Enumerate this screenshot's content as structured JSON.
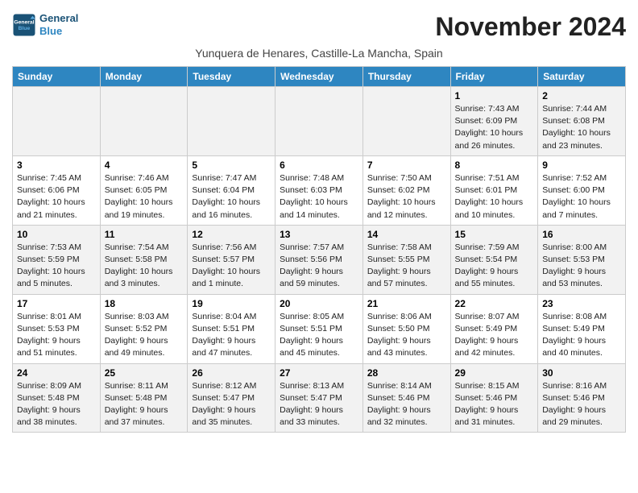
{
  "app": {
    "logo_line1": "General",
    "logo_line2": "Blue"
  },
  "header": {
    "month_title": "November 2024",
    "subtitle": "Yunquera de Henares, Castille-La Mancha, Spain"
  },
  "columns": [
    "Sunday",
    "Monday",
    "Tuesday",
    "Wednesday",
    "Thursday",
    "Friday",
    "Saturday"
  ],
  "weeks": [
    [
      {
        "day": "",
        "info": ""
      },
      {
        "day": "",
        "info": ""
      },
      {
        "day": "",
        "info": ""
      },
      {
        "day": "",
        "info": ""
      },
      {
        "day": "",
        "info": ""
      },
      {
        "day": "1",
        "info": "Sunrise: 7:43 AM\nSunset: 6:09 PM\nDaylight: 10 hours and 26 minutes."
      },
      {
        "day": "2",
        "info": "Sunrise: 7:44 AM\nSunset: 6:08 PM\nDaylight: 10 hours and 23 minutes."
      }
    ],
    [
      {
        "day": "3",
        "info": "Sunrise: 7:45 AM\nSunset: 6:06 PM\nDaylight: 10 hours and 21 minutes."
      },
      {
        "day": "4",
        "info": "Sunrise: 7:46 AM\nSunset: 6:05 PM\nDaylight: 10 hours and 19 minutes."
      },
      {
        "day": "5",
        "info": "Sunrise: 7:47 AM\nSunset: 6:04 PM\nDaylight: 10 hours and 16 minutes."
      },
      {
        "day": "6",
        "info": "Sunrise: 7:48 AM\nSunset: 6:03 PM\nDaylight: 10 hours and 14 minutes."
      },
      {
        "day": "7",
        "info": "Sunrise: 7:50 AM\nSunset: 6:02 PM\nDaylight: 10 hours and 12 minutes."
      },
      {
        "day": "8",
        "info": "Sunrise: 7:51 AM\nSunset: 6:01 PM\nDaylight: 10 hours and 10 minutes."
      },
      {
        "day": "9",
        "info": "Sunrise: 7:52 AM\nSunset: 6:00 PM\nDaylight: 10 hours and 7 minutes."
      }
    ],
    [
      {
        "day": "10",
        "info": "Sunrise: 7:53 AM\nSunset: 5:59 PM\nDaylight: 10 hours and 5 minutes."
      },
      {
        "day": "11",
        "info": "Sunrise: 7:54 AM\nSunset: 5:58 PM\nDaylight: 10 hours and 3 minutes."
      },
      {
        "day": "12",
        "info": "Sunrise: 7:56 AM\nSunset: 5:57 PM\nDaylight: 10 hours and 1 minute."
      },
      {
        "day": "13",
        "info": "Sunrise: 7:57 AM\nSunset: 5:56 PM\nDaylight: 9 hours and 59 minutes."
      },
      {
        "day": "14",
        "info": "Sunrise: 7:58 AM\nSunset: 5:55 PM\nDaylight: 9 hours and 57 minutes."
      },
      {
        "day": "15",
        "info": "Sunrise: 7:59 AM\nSunset: 5:54 PM\nDaylight: 9 hours and 55 minutes."
      },
      {
        "day": "16",
        "info": "Sunrise: 8:00 AM\nSunset: 5:53 PM\nDaylight: 9 hours and 53 minutes."
      }
    ],
    [
      {
        "day": "17",
        "info": "Sunrise: 8:01 AM\nSunset: 5:53 PM\nDaylight: 9 hours and 51 minutes."
      },
      {
        "day": "18",
        "info": "Sunrise: 8:03 AM\nSunset: 5:52 PM\nDaylight: 9 hours and 49 minutes."
      },
      {
        "day": "19",
        "info": "Sunrise: 8:04 AM\nSunset: 5:51 PM\nDaylight: 9 hours and 47 minutes."
      },
      {
        "day": "20",
        "info": "Sunrise: 8:05 AM\nSunset: 5:51 PM\nDaylight: 9 hours and 45 minutes."
      },
      {
        "day": "21",
        "info": "Sunrise: 8:06 AM\nSunset: 5:50 PM\nDaylight: 9 hours and 43 minutes."
      },
      {
        "day": "22",
        "info": "Sunrise: 8:07 AM\nSunset: 5:49 PM\nDaylight: 9 hours and 42 minutes."
      },
      {
        "day": "23",
        "info": "Sunrise: 8:08 AM\nSunset: 5:49 PM\nDaylight: 9 hours and 40 minutes."
      }
    ],
    [
      {
        "day": "24",
        "info": "Sunrise: 8:09 AM\nSunset: 5:48 PM\nDaylight: 9 hours and 38 minutes."
      },
      {
        "day": "25",
        "info": "Sunrise: 8:11 AM\nSunset: 5:48 PM\nDaylight: 9 hours and 37 minutes."
      },
      {
        "day": "26",
        "info": "Sunrise: 8:12 AM\nSunset: 5:47 PM\nDaylight: 9 hours and 35 minutes."
      },
      {
        "day": "27",
        "info": "Sunrise: 8:13 AM\nSunset: 5:47 PM\nDaylight: 9 hours and 33 minutes."
      },
      {
        "day": "28",
        "info": "Sunrise: 8:14 AM\nSunset: 5:46 PM\nDaylight: 9 hours and 32 minutes."
      },
      {
        "day": "29",
        "info": "Sunrise: 8:15 AM\nSunset: 5:46 PM\nDaylight: 9 hours and 31 minutes."
      },
      {
        "day": "30",
        "info": "Sunrise: 8:16 AM\nSunset: 5:46 PM\nDaylight: 9 hours and 29 minutes."
      }
    ]
  ]
}
